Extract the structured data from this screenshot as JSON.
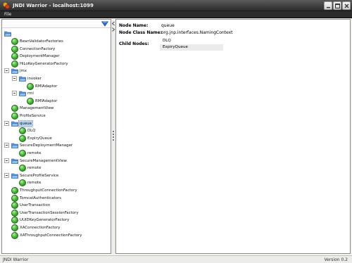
{
  "window": {
    "title": "JNDI Warrior - localhost:1099"
  },
  "menu": {
    "file": "File"
  },
  "tree": {
    "nodes": [
      {
        "label": "BeanValidatorFactories",
        "icon": "leaf"
      },
      {
        "label": "ConnectionFactory",
        "icon": "leaf"
      },
      {
        "label": "DeploymentManager",
        "icon": "leaf"
      },
      {
        "label": "HiLoKeyGeneratorFactory",
        "icon": "leaf"
      },
      {
        "label": "jmx",
        "icon": "folder",
        "expanded": true
      },
      {
        "label": "invoker",
        "icon": "folder",
        "expanded": true
      },
      {
        "label": "RMIAdaptor",
        "icon": "leaf"
      },
      {
        "label": "rmi",
        "icon": "folder",
        "expanded": true
      },
      {
        "label": "RMIAdaptor",
        "icon": "leaf"
      },
      {
        "label": "ManagementView",
        "icon": "leaf"
      },
      {
        "label": "ProfileService",
        "icon": "leaf"
      },
      {
        "label": "queue",
        "icon": "folder",
        "expanded": true,
        "selected": true
      },
      {
        "label": "DLQ",
        "icon": "leaf"
      },
      {
        "label": "ExpiryQueue",
        "icon": "leaf"
      },
      {
        "label": "SecureDeploymentManager",
        "icon": "folder",
        "expanded": true
      },
      {
        "label": "remote",
        "icon": "leaf"
      },
      {
        "label": "SecureManagementView",
        "icon": "folder",
        "expanded": true
      },
      {
        "label": "remote",
        "icon": "leaf"
      },
      {
        "label": "SecureProfileService",
        "icon": "folder",
        "expanded": true
      },
      {
        "label": "remote",
        "icon": "leaf"
      },
      {
        "label": "ThroughputConnectionFactory",
        "icon": "leaf"
      },
      {
        "label": "TomcatAuthenticators",
        "icon": "leaf"
      },
      {
        "label": "UserTransaction",
        "icon": "leaf"
      },
      {
        "label": "UserTransactionSessionFactory",
        "icon": "leaf"
      },
      {
        "label": "UUIDKeyGeneratorFactory",
        "icon": "leaf"
      },
      {
        "label": "XAConnectionFactory",
        "icon": "leaf"
      },
      {
        "label": "XAThroughputConnectionFactory",
        "icon": "leaf"
      }
    ]
  },
  "details": {
    "node_name_label": "Node Name:",
    "node_name_value": "queue",
    "class_name_label": "Node Class Name:",
    "class_name_value": "org.jnp.interfaces.NamingContext",
    "child_nodes_label": "Child Nodes:",
    "child_nodes": [
      "DLQ",
      "ExpiryQueue"
    ]
  },
  "status": {
    "left": "JNDI Warrior",
    "right": "Version 0.2"
  }
}
